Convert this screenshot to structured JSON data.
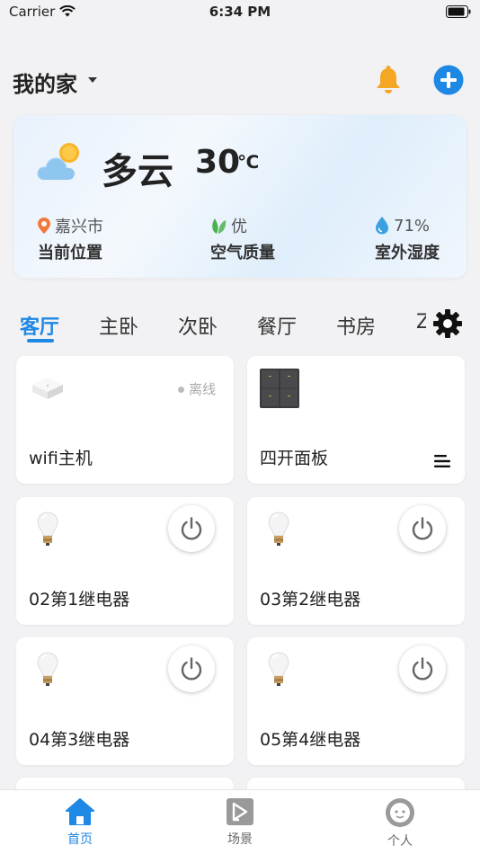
{
  "status_bar": {
    "carrier": "Carrier",
    "time": "6:34 PM"
  },
  "header": {
    "title": "我的家"
  },
  "weather": {
    "description": "多云",
    "temperature": "30",
    "unit": "℃",
    "location_value": "嘉兴市",
    "location_label": "当前位置",
    "air_value": "优",
    "air_label": "空气质量",
    "humidity_value": "71%",
    "humidity_label": "室外湿度"
  },
  "tabs": [
    {
      "label": "客厅"
    },
    {
      "label": "主卧"
    },
    {
      "label": "次卧"
    },
    {
      "label": "餐厅"
    },
    {
      "label": "书房"
    },
    {
      "label": "Z"
    }
  ],
  "devices": [
    {
      "name": "wifi主机",
      "status": "离线",
      "icon": "hub-icon"
    },
    {
      "name": "四开面板",
      "icon": "panel-icon"
    },
    {
      "name": "02第1继电器",
      "icon": "bulb-icon"
    },
    {
      "name": "03第2继电器",
      "icon": "bulb-icon"
    },
    {
      "name": "04第3继电器",
      "icon": "bulb-icon"
    },
    {
      "name": "05第4继电器",
      "icon": "bulb-icon"
    }
  ],
  "bottom_nav": [
    {
      "label": "首页",
      "icon": "home-icon"
    },
    {
      "label": "场景",
      "icon": "scene-icon"
    },
    {
      "label": "个人",
      "icon": "profile-icon"
    }
  ],
  "colors": {
    "accent": "#1e88e5",
    "bell": "#f5a623",
    "leaf": "#4caf50",
    "location_pin": "#f0793a",
    "water": "#3aa0e0"
  }
}
